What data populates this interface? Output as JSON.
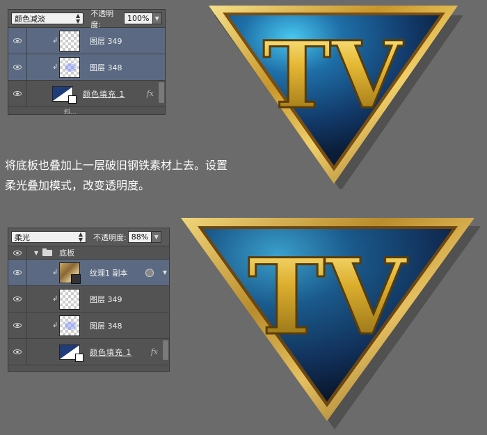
{
  "panel1": {
    "blend_mode": "颜色减淡",
    "opacity_label": "不透明度:",
    "opacity_value": "100%",
    "layers": [
      {
        "name": "图层 349"
      },
      {
        "name": "图层 348"
      },
      {
        "name": "颜色填充 1",
        "fx": "fx"
      },
      {
        "name": "斜..."
      }
    ]
  },
  "panel2": {
    "blend_mode": "柔光",
    "opacity_label": "不透明度:",
    "opacity_value": "88%",
    "group_name": "底板",
    "layers": [
      {
        "name": "纹理1 副本"
      },
      {
        "name": "图层 349"
      },
      {
        "name": "图层 348"
      },
      {
        "name": "颜色填充 1",
        "fx": "fx"
      }
    ]
  },
  "caption": {
    "line1": "将底板也叠加上一层破旧钢铁素材上去。设置",
    "line2": "柔光叠加模式，改变透明度。"
  },
  "emblem": {
    "text": "TV"
  },
  "colors": {
    "gold": "#d9a92e",
    "blue": "#1f4f8a",
    "bg": "#6b6b6b"
  }
}
